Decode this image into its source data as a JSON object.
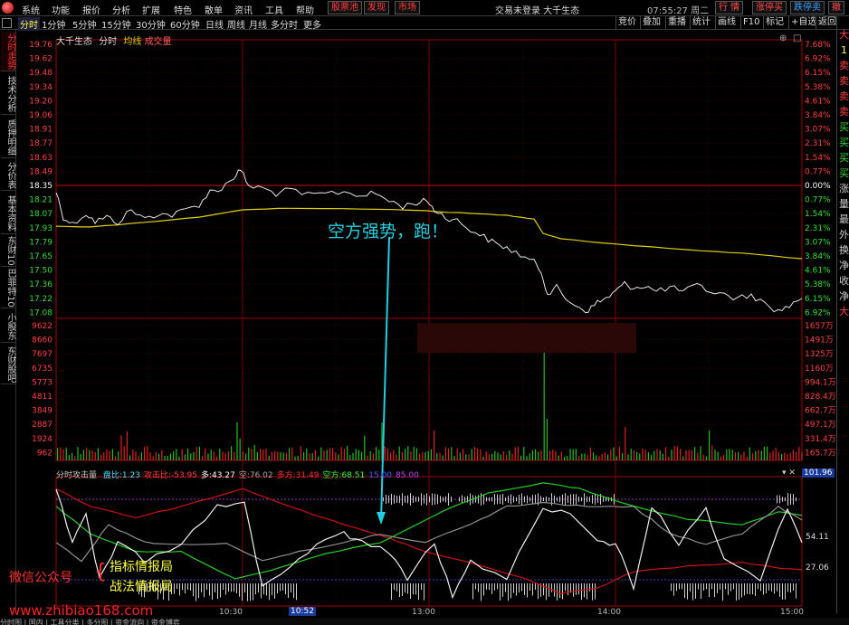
{
  "menu": {
    "items": [
      "系统",
      "功能",
      "报价",
      "分析",
      "扩展",
      "特色",
      "散单",
      "资讯",
      "工具",
      "帮助"
    ],
    "red_buttons": [
      "股票池",
      "发现",
      "市场"
    ],
    "window_title": "交易未登录 大千生态",
    "clock": "07:55:27 周二",
    "right_buttons": [
      "行 情",
      "涨停买",
      "跌停卖",
      "撤"
    ]
  },
  "toolbar": {
    "periods": [
      "分时",
      "1分钟",
      "5分钟",
      "15分钟",
      "30分钟",
      "60分钟",
      "日线",
      "周线",
      "月线",
      "多分时",
      "更多"
    ],
    "right_items": [
      "竞价",
      "叠加",
      "重播",
      "统计",
      "画线",
      "F10",
      "标记",
      "+自选",
      "返回"
    ]
  },
  "left_tabs": [
    "分时走势",
    "技术分析",
    "基本资料",
    "分价表",
    "基本资料",
    "东财10",
    "巴菲特10",
    "小股东",
    "东财股吧"
  ],
  "left_tabs_display": [
    "分时走势",
    "技术分析",
    "质押明细",
    "分价表",
    "基本资料",
    "东财10",
    "巴菲特10",
    "小股东",
    "东财股吧"
  ],
  "stock": {
    "name": "大千生态",
    "view": "分时",
    "avg_label": "均线",
    "vol_label": "成交量"
  },
  "price_axis": {
    "labels": [
      "19.76",
      "19.62",
      "19.48",
      "19.34",
      "19.20",
      "19.06",
      "18.91",
      "18.77",
      "18.63",
      "18.49",
      "18.35",
      "18.21",
      "18.07",
      "17.93",
      "17.79",
      "17.65",
      "17.50",
      "17.36",
      "17.22",
      "17.08"
    ],
    "pct_labels": [
      "7.68%",
      "6.92%",
      "6.15%",
      "5.38%",
      "4.61%",
      "3.84%",
      "3.07%",
      "2.31%",
      "1.54%",
      "0.77%",
      "0.00%",
      "0.77%",
      "1.54%",
      "2.31%",
      "3.07%",
      "3.84%",
      "4.61%",
      "5.38%",
      "6.15%",
      "6.92%"
    ],
    "base": "18.35",
    "base_pct": "0.00%"
  },
  "volume_axis": {
    "labels": [
      "9622",
      "8660",
      "7697",
      "6735",
      "5773",
      "4811",
      "3849",
      "2887",
      "1924",
      "962"
    ],
    "right_labels": [
      "1657万",
      "1491万",
      "1325万",
      "1160万",
      "994.1万",
      "828.4万",
      "662.7万",
      "497.1万",
      "331.4万",
      "165.7万"
    ]
  },
  "oscillator": {
    "title": "分时攻击量",
    "items": [
      {
        "label": "盘比:",
        "value": "1.23",
        "color": "#40e0ff"
      },
      {
        "label": "攻击比:",
        "value": "-53.95",
        "color": "#ff4040"
      },
      {
        "label": "多:",
        "value": "43.27",
        "color": "#ffffff"
      },
      {
        "label": "空:",
        "value": "76.02",
        "color": "#aaaaaa"
      },
      {
        "label": "多方:",
        "value": "31.49",
        "color": "#ff3030"
      },
      {
        "label": "空方:",
        "value": "68.51",
        "color": "#30ff30"
      },
      {
        "label": "",
        "value": "15.00",
        "color": "#4060ff"
      },
      {
        "label": "",
        "value": "85.00",
        "color": "#c040ff"
      }
    ],
    "right_value": "101.96",
    "right_labels": [
      "54.11",
      "27.06"
    ]
  },
  "annotation": "空方强势，跑！",
  "time_axis": {
    "labels": [
      "10:30",
      "13:00",
      "14:00",
      "15:00"
    ],
    "cursor": "10:52"
  },
  "watermark": {
    "wechat": "微信公众号",
    "line1": "指标情报局",
    "line2": "战法情报局",
    "url": "www.zhibiao168.com"
  },
  "right_panel": [
    "大",
    "1",
    "卖",
    "卖",
    "卖",
    "卖",
    "买",
    "买",
    "买",
    "买",
    "涨",
    "量",
    "最",
    "外",
    "换",
    "净",
    "收",
    "净",
    "大"
  ],
  "bottom_bar": "分时图 | 国内 | 工具分类 | 多分图 | 资金流向 | 资金博弈",
  "colors": {
    "price_line": "#e8e8e8",
    "avg_line": "#e0d000",
    "grid_red": "#7a0000",
    "up": "#ff3030",
    "down": "#30e030"
  }
}
